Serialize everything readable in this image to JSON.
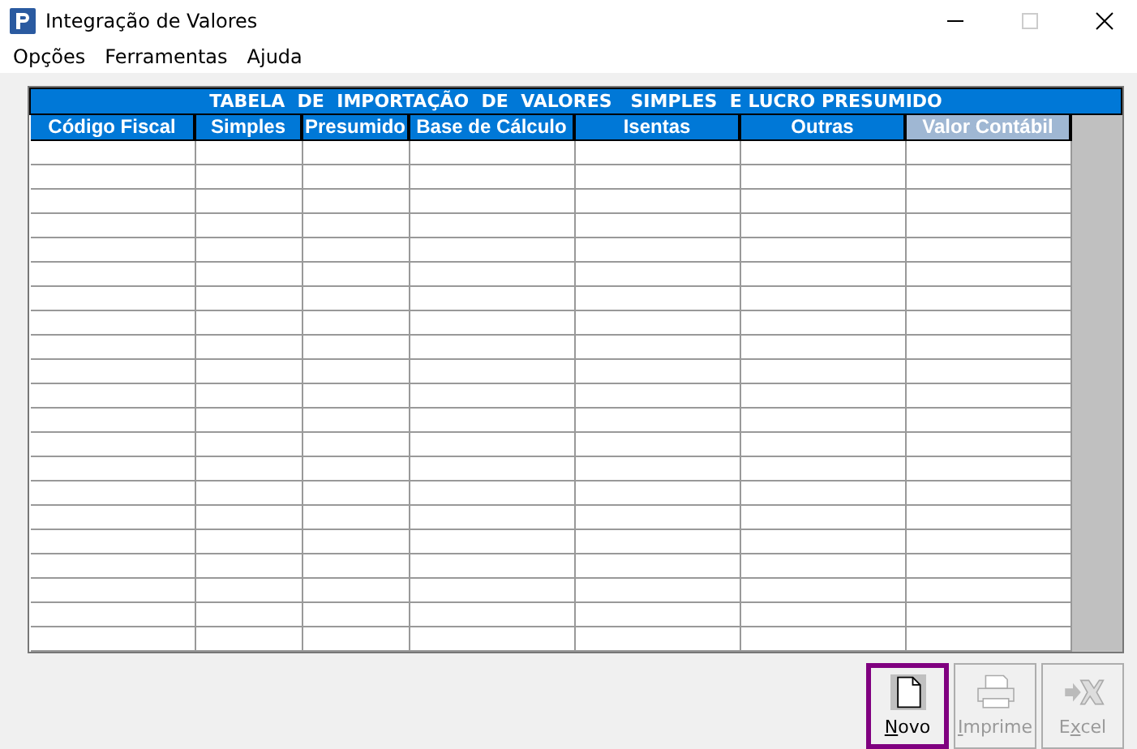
{
  "window": {
    "title": "Integração de Valores"
  },
  "menu": [
    "Opções",
    "Ferramentas",
    "Ajuda"
  ],
  "table": {
    "title": "TABELA  DE  IMPORTAÇÃO  DE  VALORES   SIMPLES  E LUCRO PRESUMIDO",
    "columns": [
      {
        "label": "Código Fiscal",
        "disabled": false
      },
      {
        "label": "Simples",
        "disabled": false
      },
      {
        "label": "Presumido",
        "disabled": false
      },
      {
        "label": "Base de Cálculo",
        "disabled": false
      },
      {
        "label": "Isentas",
        "disabled": false
      },
      {
        "label": "Outras",
        "disabled": false
      },
      {
        "label": "Valor Contábil",
        "disabled": true
      }
    ]
  },
  "buttons": [
    {
      "kind": "new",
      "label": [
        {
          "text": "N",
          "underlined": true
        },
        {
          "text": "ovo",
          "underlined": false
        }
      ],
      "disabled": false,
      "selected": true
    },
    {
      "kind": "print",
      "label": [
        {
          "text": "I",
          "underlined": true
        },
        {
          "text": "mprime",
          "underlined": false
        }
      ],
      "disabled": true,
      "selected": false
    },
    {
      "kind": "excel",
      "label": [
        {
          "text": "E",
          "underlined": false
        },
        {
          "text": "x",
          "underlined": true
        },
        {
          "text": "cel",
          "underlined": false
        }
      ],
      "disabled": true,
      "selected": false
    }
  ]
}
